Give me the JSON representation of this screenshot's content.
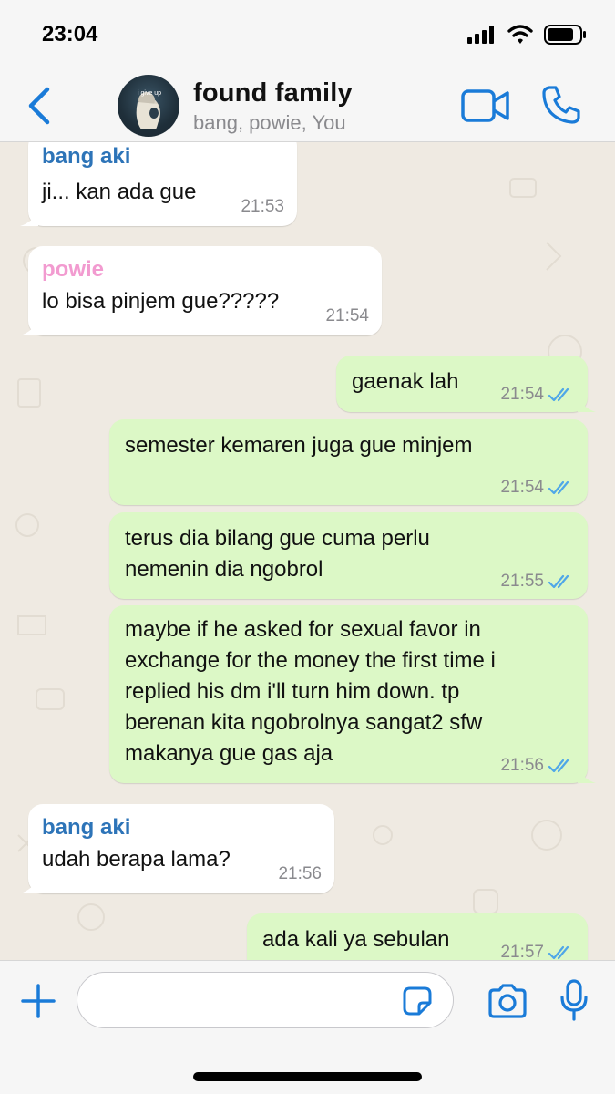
{
  "status_bar": {
    "time": "23:04",
    "icons": [
      "signal-icon",
      "wifi-icon",
      "battery-icon"
    ]
  },
  "header": {
    "title": "found family",
    "subtitle": "bang, powie, You",
    "avatar_caption": "i give up",
    "icons": [
      "chevron-left-icon",
      "video-call-icon",
      "phone-icon"
    ]
  },
  "colors": {
    "accent": "#1a7bd8",
    "sender_bang_aki": "#2d74b8",
    "sender_powie": "#f29bd0",
    "outgoing_bubble": "#dcf8c6",
    "incoming_bubble": "#ffffff",
    "read_ticks": "#4fa7e8"
  },
  "messages": [
    {
      "direction": "in",
      "sender": "bang aki",
      "text": "ji... kan ada gue",
      "time": "21:53"
    },
    {
      "direction": "in",
      "sender": "powie",
      "text": "lo bisa pinjem gue?????",
      "time": "21:54"
    },
    {
      "direction": "out",
      "text": "gaenak lah",
      "time": "21:54"
    },
    {
      "direction": "out",
      "text": "semester kemaren juga gue minjem",
      "time": "21:54"
    },
    {
      "direction": "out",
      "text": "terus dia bilang gue cuma perlu\nnemenin dia ngobrol",
      "time": "21:55"
    },
    {
      "direction": "out",
      "text": "maybe if he asked for sexual favor in\nexchange for the money the first time i\nreplied his dm i'll turn him down. tp\nberenan kita ngobrolnya sangat2 sfw\nmakanya gue gas aja",
      "time": "21:56"
    },
    {
      "direction": "in",
      "sender": "bang aki",
      "text": "udah berapa lama?",
      "time": "21:56"
    },
    {
      "direction": "out",
      "text": "ada kali ya sebulan",
      "time": "21:57"
    }
  ],
  "input_bar": {
    "placeholder": "",
    "icons": [
      "plus-icon",
      "sticker-icon",
      "camera-icon",
      "microphone-icon"
    ]
  }
}
